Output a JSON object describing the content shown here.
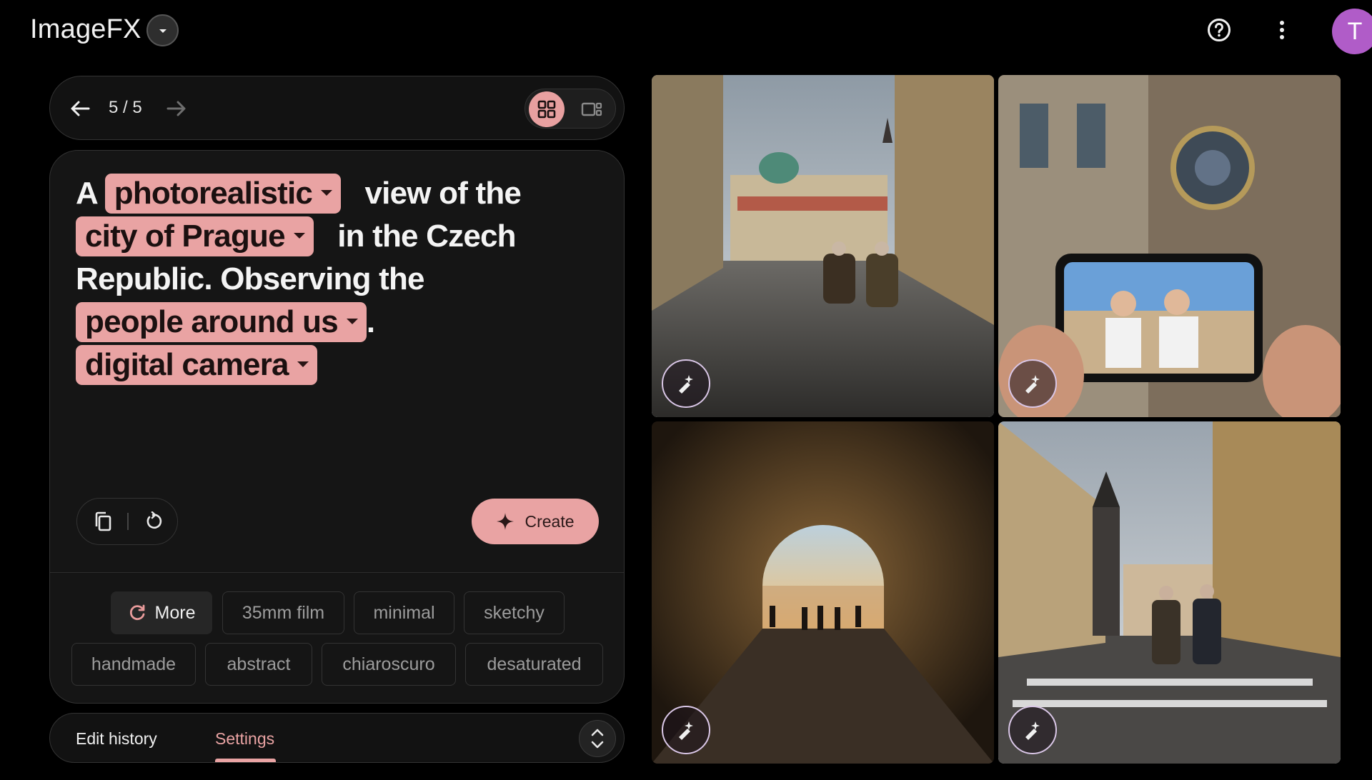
{
  "app": {
    "title": "ImageFX",
    "avatar_letter": "T"
  },
  "icons": {
    "app_dropdown": "chevron-down-icon",
    "help": "help-circle-icon",
    "more": "more-vert-icon",
    "back": "arrow-left-icon",
    "forward": "arrow-right-icon",
    "grid_view": "grid-icon",
    "single_view": "single-view-icon",
    "copy": "copy-icon",
    "reset": "reset-icon",
    "create": "sparkle-icon",
    "refresh": "refresh-icon",
    "expand": "unfold-icon",
    "edit": "magic-edit-icon"
  },
  "nav": {
    "count": "5 / 5"
  },
  "prompt": {
    "t1": "A",
    "c1": "photorealistic",
    "t2": "view of the",
    "c2": "city of Prague",
    "t3": "in the Czech Republic. Observing the",
    "c3": "people around us",
    "t4": ".",
    "c4": "digital camera"
  },
  "actions": {
    "create_label": "Create"
  },
  "suggestions": {
    "more_label": "More",
    "items": [
      "35mm film",
      "minimal",
      "sketchy",
      "handmade",
      "abstract",
      "chiaroscuro",
      "desaturated"
    ]
  },
  "tabs": {
    "edit_history": "Edit history",
    "settings": "Settings"
  },
  "colors": {
    "accent": "#e9a3a3",
    "avatar": "#b05cc8",
    "background": "#000000",
    "panel": "#151515"
  }
}
